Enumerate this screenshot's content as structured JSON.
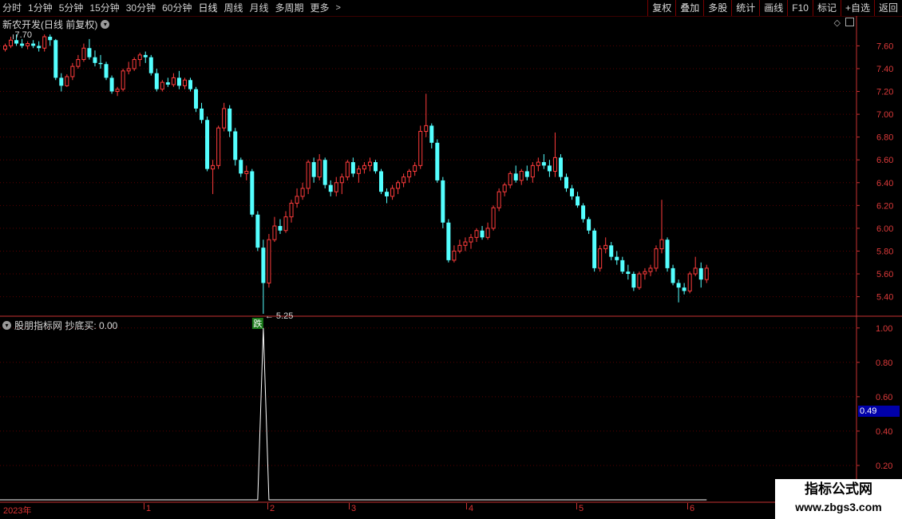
{
  "toolbar": {
    "periods": [
      "分时",
      "1分钟",
      "5分钟",
      "15分钟",
      "30分钟",
      "60分钟",
      "日线",
      "周线",
      "月线",
      "多周期",
      "更多"
    ],
    "active_period": "日线",
    "more_arrow": ">",
    "right_buttons": [
      "复权",
      "叠加",
      "多股",
      "统计",
      "画线",
      "F10",
      "标记",
      "+自选",
      "返回"
    ]
  },
  "stock": {
    "name_label": "新农开发(日线 前复权)",
    "high_marker": "7.70",
    "low_marker": "5.25",
    "signal_label": "跌"
  },
  "indicator": {
    "title": "股朋指标网 抄底买: 0.00",
    "current_value": "0.49"
  },
  "price_axis": [
    "7.60",
    "7.40",
    "7.20",
    "7.00",
    "6.80",
    "6.60",
    "6.40",
    "6.20",
    "6.00",
    "5.80",
    "5.60",
    "5.40"
  ],
  "indicator_axis": [
    "1.00",
    "0.80",
    "0.60",
    "0.40",
    "0.20"
  ],
  "date_axis": [
    "2023年",
    "1",
    "2",
    "3",
    "4",
    "5",
    "6"
  ],
  "watermark": {
    "line1": "指标公式网",
    "line2": "www.zbgs3.com"
  },
  "colors": {
    "up": "#ff3c3c",
    "down": "#54ffff",
    "grid": "#5a0000",
    "axis": "#c83232",
    "indicator_line": "#ffffff"
  },
  "chart_data": [
    {
      "type": "candlestick",
      "title": "新农开发(日线 前复权)",
      "ylim": [
        5.25,
        7.75
      ],
      "y_ticks": [
        7.6,
        7.4,
        7.2,
        7.0,
        6.8,
        6.6,
        6.4,
        6.2,
        6.0,
        5.8,
        5.6,
        5.4
      ],
      "x_ticks": [
        "2023年",
        "1",
        "2",
        "3",
        "4",
        "5",
        "6"
      ],
      "annotations": [
        {
          "label": "7.70",
          "type": "high"
        },
        {
          "label": "5.25",
          "type": "low"
        },
        {
          "label": "跌",
          "type": "signal"
        }
      ],
      "ohlc": [
        [
          7.57,
          7.62,
          7.55,
          7.6
        ],
        [
          7.6,
          7.68,
          7.58,
          7.65
        ],
        [
          7.65,
          7.7,
          7.6,
          7.62
        ],
        [
          7.62,
          7.66,
          7.58,
          7.6
        ],
        [
          7.6,
          7.64,
          7.57,
          7.62
        ],
        [
          7.62,
          7.65,
          7.58,
          7.6
        ],
        [
          7.6,
          7.64,
          7.55,
          7.58
        ],
        [
          7.58,
          7.7,
          7.55,
          7.68
        ],
        [
          7.68,
          7.7,
          7.6,
          7.65
        ],
        [
          7.65,
          7.66,
          7.3,
          7.32
        ],
        [
          7.32,
          7.36,
          7.2,
          7.25
        ],
        [
          7.25,
          7.35,
          7.24,
          7.33
        ],
        [
          7.33,
          7.45,
          7.3,
          7.42
        ],
        [
          7.42,
          7.52,
          7.4,
          7.48
        ],
        [
          7.48,
          7.62,
          7.46,
          7.58
        ],
        [
          7.58,
          7.66,
          7.48,
          7.5
        ],
        [
          7.5,
          7.56,
          7.42,
          7.45
        ],
        [
          7.45,
          7.52,
          7.4,
          7.44
        ],
        [
          7.44,
          7.46,
          7.3,
          7.32
        ],
        [
          7.32,
          7.34,
          7.18,
          7.2
        ],
        [
          7.2,
          7.24,
          7.16,
          7.22
        ],
        [
          7.22,
          7.4,
          7.2,
          7.38
        ],
        [
          7.38,
          7.46,
          7.35,
          7.4
        ],
        [
          7.4,
          7.5,
          7.38,
          7.48
        ],
        [
          7.48,
          7.54,
          7.42,
          7.52
        ],
        [
          7.52,
          7.55,
          7.45,
          7.5
        ],
        [
          7.5,
          7.52,
          7.34,
          7.36
        ],
        [
          7.36,
          7.4,
          7.2,
          7.22
        ],
        [
          7.22,
          7.3,
          7.2,
          7.28
        ],
        [
          7.28,
          7.32,
          7.24,
          7.26
        ],
        [
          7.26,
          7.36,
          7.24,
          7.32
        ],
        [
          7.32,
          7.38,
          7.22,
          7.25
        ],
        [
          7.25,
          7.32,
          7.22,
          7.3
        ],
        [
          7.3,
          7.32,
          7.2,
          7.22
        ],
        [
          7.22,
          7.24,
          7.02,
          7.05
        ],
        [
          7.05,
          7.1,
          6.92,
          6.95
        ],
        [
          6.95,
          6.98,
          6.5,
          6.52
        ],
        [
          6.52,
          6.6,
          6.3,
          6.55
        ],
        [
          6.55,
          6.9,
          6.52,
          6.88
        ],
        [
          6.88,
          7.1,
          6.85,
          7.05
        ],
        [
          7.05,
          7.08,
          6.8,
          6.85
        ],
        [
          6.85,
          6.88,
          6.55,
          6.6
        ],
        [
          6.6,
          6.62,
          6.45,
          6.48
        ],
        [
          6.48,
          6.55,
          6.42,
          6.5
        ],
        [
          6.5,
          6.52,
          6.1,
          6.12
        ],
        [
          6.12,
          6.15,
          5.8,
          5.83
        ],
        [
          5.83,
          5.9,
          5.25,
          5.52
        ],
        [
          5.52,
          5.95,
          5.48,
          5.9
        ],
        [
          5.9,
          6.1,
          5.88,
          6.02
        ],
        [
          6.02,
          6.08,
          5.95,
          5.98
        ],
        [
          5.98,
          6.15,
          5.96,
          6.1
        ],
        [
          6.1,
          6.25,
          6.05,
          6.22
        ],
        [
          6.22,
          6.35,
          6.18,
          6.28
        ],
        [
          6.28,
          6.4,
          6.25,
          6.35
        ],
        [
          6.35,
          6.6,
          6.3,
          6.58
        ],
        [
          6.58,
          6.62,
          6.4,
          6.45
        ],
        [
          6.45,
          6.65,
          6.42,
          6.6
        ],
        [
          6.6,
          6.62,
          6.35,
          6.38
        ],
        [
          6.38,
          6.42,
          6.28,
          6.32
        ],
        [
          6.32,
          6.45,
          6.28,
          6.4
        ],
        [
          6.4,
          6.48,
          6.3,
          6.45
        ],
        [
          6.45,
          6.6,
          6.42,
          6.58
        ],
        [
          6.58,
          6.62,
          6.45,
          6.48
        ],
        [
          6.48,
          6.55,
          6.4,
          6.52
        ],
        [
          6.52,
          6.58,
          6.48,
          6.55
        ],
        [
          6.55,
          6.62,
          6.5,
          6.58
        ],
        [
          6.58,
          6.6,
          6.48,
          6.5
        ],
        [
          6.5,
          6.52,
          6.3,
          6.32
        ],
        [
          6.32,
          6.35,
          6.22,
          6.28
        ],
        [
          6.28,
          6.38,
          6.25,
          6.35
        ],
        [
          6.35,
          6.42,
          6.3,
          6.4
        ],
        [
          6.4,
          6.48,
          6.36,
          6.45
        ],
        [
          6.45,
          6.52,
          6.4,
          6.5
        ],
        [
          6.5,
          6.58,
          6.46,
          6.55
        ],
        [
          6.55,
          6.9,
          6.52,
          6.85
        ],
        [
          6.85,
          7.18,
          6.8,
          6.9
        ],
        [
          6.9,
          6.92,
          6.7,
          6.75
        ],
        [
          6.75,
          6.78,
          6.4,
          6.42
        ],
        [
          6.42,
          6.45,
          6.0,
          6.05
        ],
        [
          6.05,
          6.08,
          5.7,
          5.72
        ],
        [
          5.72,
          5.85,
          5.7,
          5.8
        ],
        [
          5.8,
          5.9,
          5.78,
          5.85
        ],
        [
          5.85,
          5.92,
          5.8,
          5.88
        ],
        [
          5.88,
          5.95,
          5.82,
          5.92
        ],
        [
          5.92,
          6.0,
          5.88,
          5.98
        ],
        [
          5.98,
          6.02,
          5.9,
          5.92
        ],
        [
          5.92,
          6.05,
          5.9,
          6.0
        ],
        [
          6.0,
          6.2,
          5.98,
          6.18
        ],
        [
          6.18,
          6.35,
          6.15,
          6.32
        ],
        [
          6.32,
          6.4,
          6.28,
          6.38
        ],
        [
          6.38,
          6.5,
          6.35,
          6.48
        ],
        [
          6.48,
          6.55,
          6.4,
          6.42
        ],
        [
          6.42,
          6.52,
          6.38,
          6.5
        ],
        [
          6.5,
          6.55,
          6.42,
          6.45
        ],
        [
          6.45,
          6.58,
          6.4,
          6.55
        ],
        [
          6.55,
          6.62,
          6.5,
          6.58
        ],
        [
          6.58,
          6.65,
          6.52,
          6.55
        ],
        [
          6.55,
          6.6,
          6.45,
          6.5
        ],
        [
          6.5,
          6.84,
          6.45,
          6.62
        ],
        [
          6.62,
          6.65,
          6.42,
          6.45
        ],
        [
          6.45,
          6.48,
          6.32,
          6.35
        ],
        [
          6.35,
          6.38,
          6.25,
          6.28
        ],
        [
          6.28,
          6.32,
          6.18,
          6.2
        ],
        [
          6.2,
          6.22,
          6.05,
          6.08
        ],
        [
          6.08,
          6.1,
          5.95,
          5.98
        ],
        [
          5.98,
          6.0,
          5.62,
          5.65
        ],
        [
          5.65,
          5.85,
          5.62,
          5.82
        ],
        [
          5.82,
          5.92,
          5.78,
          5.85
        ],
        [
          5.85,
          5.88,
          5.72,
          5.75
        ],
        [
          5.75,
          5.8,
          5.68,
          5.72
        ],
        [
          5.72,
          5.75,
          5.6,
          5.62
        ],
        [
          5.62,
          5.68,
          5.55,
          5.6
        ],
        [
          5.6,
          5.62,
          5.45,
          5.48
        ],
        [
          5.48,
          5.62,
          5.46,
          5.6
        ],
        [
          5.6,
          5.65,
          5.55,
          5.62
        ],
        [
          5.62,
          5.68,
          5.58,
          5.65
        ],
        [
          5.65,
          5.85,
          5.62,
          5.82
        ],
        [
          5.82,
          6.25,
          5.78,
          5.9
        ],
        [
          5.9,
          5.92,
          5.62,
          5.65
        ],
        [
          5.65,
          5.68,
          5.5,
          5.52
        ],
        [
          5.52,
          5.55,
          5.35,
          5.48
        ],
        [
          5.48,
          5.52,
          5.42,
          5.45
        ],
        [
          5.45,
          5.62,
          5.43,
          5.6
        ],
        [
          5.6,
          5.75,
          5.58,
          5.65
        ],
        [
          5.65,
          5.7,
          5.48,
          5.55
        ],
        [
          5.55,
          5.68,
          5.52,
          5.65
        ]
      ]
    },
    {
      "type": "line",
      "title": "股朋指标网 抄底买: 0.00",
      "series": [
        {
          "name": "抄底买",
          "peak_value": 1.0,
          "baseline_value": 0.0
        }
      ],
      "ylim": [
        0,
        1.05
      ],
      "y_ticks": [
        1.0,
        0.8,
        0.6,
        0.4,
        0.2
      ]
    }
  ]
}
